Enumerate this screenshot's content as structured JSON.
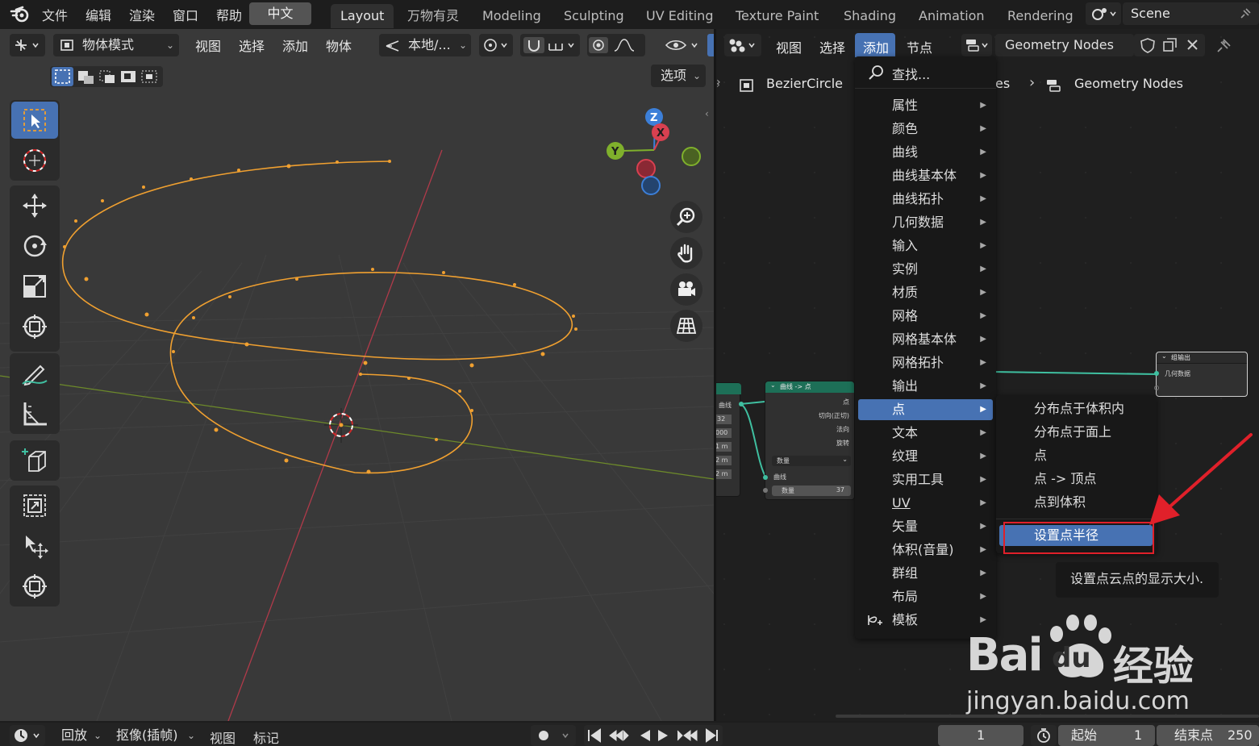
{
  "top_menu": {
    "items": [
      "文件",
      "编辑",
      "渲染",
      "窗口",
      "帮助"
    ],
    "language_button": "中文"
  },
  "workspace_tabs": [
    "Layout",
    "万物有灵",
    "Modeling",
    "Sculpting",
    "UV Editing",
    "Texture Paint",
    "Shading",
    "Animation",
    "Rendering"
  ],
  "active_workspace": "Layout",
  "scene": {
    "name": "Scene"
  },
  "viewport": {
    "mode_label": "物体模式",
    "menus": [
      "视图",
      "选择",
      "添加",
      "物体"
    ],
    "transform_orientation": "本地/...",
    "options_label": "选项",
    "gizmo_axes": [
      "Z",
      "Y",
      "X"
    ]
  },
  "node_editor": {
    "menus": [
      "视图",
      "选择",
      "添加",
      "节点"
    ],
    "active_menu": "添加",
    "tree_name": "Geometry Nodes",
    "breadcrumb": [
      "BezierCircle",
      "es",
      "Geometry Nodes"
    ],
    "nodes": {
      "left_stub": {
        "label": "曲线",
        "values": [
          "32",
          "000",
          "1 m",
          "2 m",
          "2 m"
        ]
      },
      "curve_to_points": {
        "title": "曲线 -> 点",
        "outputs": [
          "点",
          "切向(正切)",
          "法向",
          "旋转"
        ],
        "mode": "数量",
        "input_label": "曲线",
        "count_label": "数量",
        "count_value": "37"
      },
      "group_output": {
        "title": "组输出",
        "socket": "几何数据"
      }
    }
  },
  "add_menu": {
    "search": "查找...",
    "items": [
      "属性",
      "颜色",
      "曲线",
      "曲线基本体",
      "曲线拓扑",
      "几何数据",
      "输入",
      "实例",
      "材质",
      "网格",
      "网格基本体",
      "网格拓扑",
      "输出",
      "点",
      "文本",
      "纹理",
      "实用工具",
      "UV",
      "矢量",
      "体积(音量)",
      "群组",
      "布局",
      "模板"
    ],
    "highlighted": "点"
  },
  "point_submenu": {
    "items": [
      "分布点于体积内",
      "分布点于面上",
      "点",
      "点 -> 顶点",
      "点到体积"
    ],
    "highlighted_item": "设置点半径"
  },
  "tooltip": "设置点云点的显示大小.",
  "timeline": {
    "playback": "回放",
    "keying": "抠像(插帧)",
    "view": "视图",
    "marker": "标记",
    "current_frame": "1",
    "start_label": "起始",
    "start_value": "1",
    "end_label": "结束点",
    "end_value": "250"
  },
  "watermark": {
    "brand": "Bai",
    "du": "du",
    "cn": "经验",
    "url": "jingyan.baidu.com"
  },
  "colors": {
    "accent": "#4772b3",
    "curve": "#f0a030",
    "highlight_box": "#e0202a",
    "node_header_green": "#1d6f57",
    "link": "#3fbfa0"
  }
}
